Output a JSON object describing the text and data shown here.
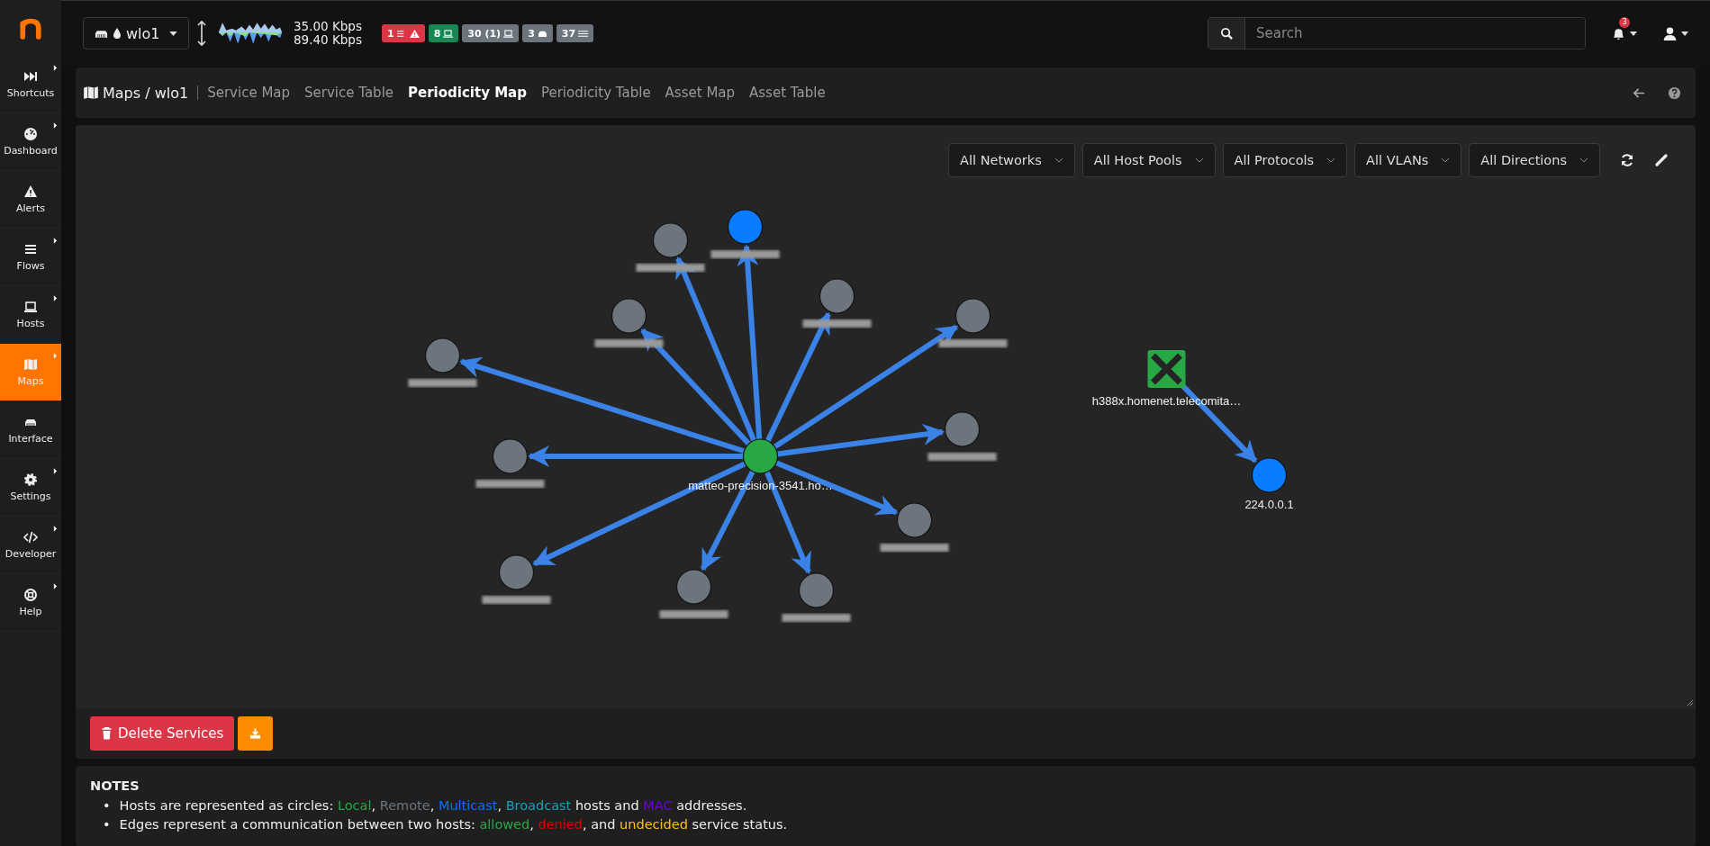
{
  "interface": {
    "name": "wlo1",
    "upload": "35.00 Kbps",
    "download": "89.40 Kbps"
  },
  "badges": [
    {
      "text": "1",
      "kind": "alerts",
      "color": "#dc3545"
    },
    {
      "text": "8",
      "kind": "local",
      "color": "#198754"
    },
    {
      "text": "30 (1)",
      "kind": "hosts",
      "color": "#6c757d"
    },
    {
      "text": "3",
      "kind": "devices",
      "color": "#6c757d"
    },
    {
      "text": "37",
      "kind": "flows",
      "color": "#6c757d"
    }
  ],
  "search": {
    "placeholder": "Search"
  },
  "notifications": {
    "count": "3"
  },
  "sidebar": {
    "items": [
      {
        "label": "Shortcuts",
        "submenu": true,
        "selected": false
      },
      {
        "label": "Dashboard",
        "submenu": true,
        "selected": false
      },
      {
        "label": "Alerts",
        "submenu": false,
        "selected": false
      },
      {
        "label": "Flows",
        "submenu": true,
        "selected": false
      },
      {
        "label": "Hosts",
        "submenu": true,
        "selected": false
      },
      {
        "label": "Maps",
        "submenu": true,
        "selected": true
      },
      {
        "label": "Interface",
        "submenu": false,
        "selected": false
      },
      {
        "label": "Settings",
        "submenu": true,
        "selected": false
      },
      {
        "label": "Developer",
        "submenu": true,
        "selected": false
      },
      {
        "label": "Help",
        "submenu": true,
        "selected": false
      }
    ]
  },
  "breadcrumb": {
    "title": "Maps / wlo1",
    "tabs": [
      {
        "label": "Service Map",
        "selected": false
      },
      {
        "label": "Service Table",
        "selected": false
      },
      {
        "label": "Periodicity Map",
        "selected": true
      },
      {
        "label": "Periodicity Table",
        "selected": false
      },
      {
        "label": "Asset Map",
        "selected": false
      },
      {
        "label": "Asset Table",
        "selected": false
      }
    ]
  },
  "filters": [
    "All Networks",
    "All Host Pools",
    "All Protocols",
    "All VLANs",
    "All Directions"
  ],
  "graph": {
    "clusters": [
      {
        "hub": {
          "kind": "local",
          "label": "matteo-precision-3541.ho…"
        },
        "peers": [
          {
            "kind": "remote",
            "label_blurred": true
          },
          {
            "kind": "multicast",
            "label_blurred": true
          },
          {
            "kind": "remote",
            "label_blurred": true
          },
          {
            "kind": "remote",
            "label_blurred": true
          },
          {
            "kind": "remote",
            "label_blurred": true
          },
          {
            "kind": "remote",
            "label_blurred": true
          },
          {
            "kind": "remote",
            "label_blurred": true
          },
          {
            "kind": "remote",
            "label_blurred": true
          },
          {
            "kind": "remote",
            "label_blurred": true
          },
          {
            "kind": "remote",
            "label_blurred": true
          },
          {
            "kind": "remote",
            "label_blurred": true
          },
          {
            "kind": "remote",
            "label_blurred": true
          }
        ]
      },
      {
        "hub": {
          "kind": "router",
          "label": "h388x.homenet.telecomita…"
        },
        "peers": [
          {
            "kind": "multicast",
            "label": "224.0.0.1"
          }
        ]
      }
    ]
  },
  "actions": [
    {
      "label": "Delete Services",
      "kind": "delete"
    },
    {
      "kind": "download"
    }
  ],
  "notes": {
    "title": "NOTES",
    "items": [
      {
        "bullet": "•",
        "parts": [
          {
            "text": "Hosts are represented as circles: "
          },
          {
            "text": "Local",
            "color": "#28a745"
          },
          {
            "text": ", "
          },
          {
            "text": "Remote",
            "color": "#6c757d"
          },
          {
            "text": ", "
          },
          {
            "text": "Multicast",
            "color": "#0d6efd"
          },
          {
            "text": ", "
          },
          {
            "text": "Broadcast",
            "color": "#17a2b8"
          },
          {
            "text": " hosts and "
          },
          {
            "text": "MAC",
            "color": "#6f00d8"
          },
          {
            "text": " addresses."
          }
        ]
      },
      {
        "bullet": "•",
        "parts": [
          {
            "text": "Edges represent a communication between two hosts: "
          },
          {
            "text": "allowed",
            "color": "#28a745"
          },
          {
            "text": ", "
          },
          {
            "text": "denied",
            "color": "#e00000"
          },
          {
            "text": ", and "
          },
          {
            "text": "undecided",
            "color": "#ffc107"
          },
          {
            "text": " service status."
          }
        ]
      }
    ]
  }
}
